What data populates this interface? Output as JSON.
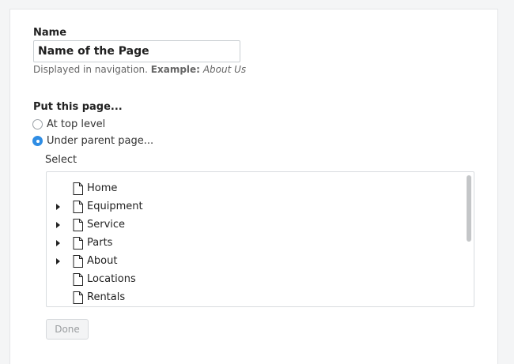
{
  "form": {
    "name_label": "Name",
    "name_value": "Name of the Page",
    "hint_prefix": "Displayed in navigation.",
    "hint_example_label": "Example:",
    "hint_example_value": "About Us",
    "placement_label": "Put this page...",
    "option_top": "At top level",
    "option_parent": "Under parent page...",
    "selected_option": "Under parent page...",
    "select_label": "Select",
    "done_label": "Done"
  },
  "tree": [
    {
      "label": "Home",
      "expandable": false
    },
    {
      "label": "Equipment",
      "expandable": true
    },
    {
      "label": "Service",
      "expandable": true
    },
    {
      "label": "Parts",
      "expandable": true
    },
    {
      "label": "About",
      "expandable": true
    },
    {
      "label": "Locations",
      "expandable": false
    },
    {
      "label": "Rentals",
      "expandable": false
    }
  ],
  "icons": {
    "page": "page-icon",
    "expand": "caret-right-icon"
  },
  "colors": {
    "radio_selected": "#2f8de4",
    "done_disabled_text": "#9a9da0"
  }
}
